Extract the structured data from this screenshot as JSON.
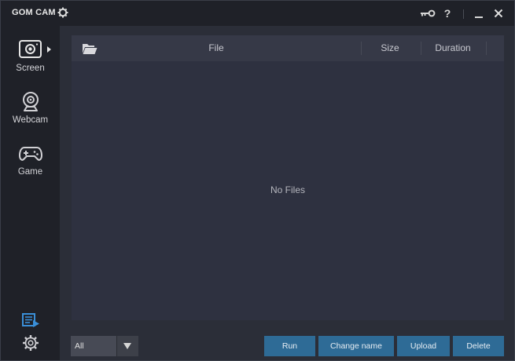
{
  "window": {
    "title": "GOM CAM"
  },
  "titlebar": {
    "help_label": "?",
    "minimize_label": "_",
    "close_label": "×",
    "icons": [
      "gear-icon",
      "key-icon",
      "help-icon",
      "minimize-icon",
      "close-icon"
    ]
  },
  "sidebar": {
    "items": [
      {
        "label": "Screen",
        "icon": "screen-record-icon"
      },
      {
        "label": "Webcam",
        "icon": "webcam-icon"
      },
      {
        "label": "Game",
        "icon": "gamepad-icon"
      }
    ],
    "bottom_icons": [
      "video-list-icon",
      "settings-gear-icon"
    ]
  },
  "file_list": {
    "columns": [
      "File",
      "Size",
      "Duration"
    ],
    "empty_message": "No Files",
    "rows": []
  },
  "footer": {
    "filter_value": "All",
    "buttons": {
      "run": "Run",
      "change_name": "Change name",
      "upload": "Upload",
      "delete": "Delete"
    }
  },
  "colors": {
    "accent_button": "#2e6b96",
    "sidebar_bg": "#1f2128",
    "panel_bg": "#2e3140",
    "header_bg": "#363947",
    "active_icon": "#3a8fd8"
  }
}
